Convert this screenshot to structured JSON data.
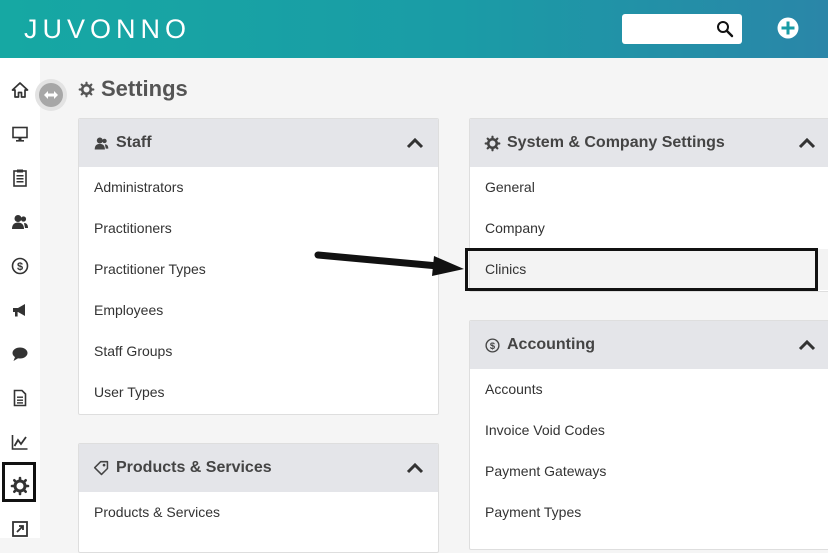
{
  "app": {
    "logo_text": "JUVONNO"
  },
  "header": {
    "search": {
      "value": "",
      "placeholder": "",
      "icon": "search-icon"
    },
    "add_icon": "plus-circle-icon"
  },
  "sidebar": {
    "items": [
      {
        "name": "home",
        "icon": "home-icon"
      },
      {
        "name": "display",
        "icon": "monitor-icon"
      },
      {
        "name": "clipboard",
        "icon": "clipboard-icon"
      },
      {
        "name": "staff",
        "icon": "users-icon"
      },
      {
        "name": "billing",
        "icon": "dollar-circle-icon"
      },
      {
        "name": "marketing",
        "icon": "megaphone-icon"
      },
      {
        "name": "messages",
        "icon": "chat-icon"
      },
      {
        "name": "documents",
        "icon": "document-icon"
      },
      {
        "name": "reports",
        "icon": "chart-icon"
      },
      {
        "name": "settings",
        "icon": "gear-icon",
        "active": true
      },
      {
        "name": "external",
        "icon": "external-link-icon"
      }
    ]
  },
  "page": {
    "title": "Settings"
  },
  "sections": {
    "staff": {
      "title": "Staff",
      "items": [
        "Administrators",
        "Practitioners",
        "Practitioner Types",
        "Employees",
        "Staff Groups",
        "User Types"
      ]
    },
    "products": {
      "title": "Products & Services",
      "items": [
        "Products & Services"
      ]
    },
    "system": {
      "title": "System & Company Settings",
      "items": [
        "General",
        "Company",
        "Clinics"
      ]
    },
    "accounting": {
      "title": "Accounting",
      "items": [
        "Accounts",
        "Invoice Void Codes",
        "Payment Gateways",
        "Payment Types"
      ]
    }
  },
  "colors": {
    "header_start": "#16a8a3",
    "header_end": "#2a86a8",
    "card_header": "#e4e5e9",
    "highlight_border": "#111111"
  }
}
